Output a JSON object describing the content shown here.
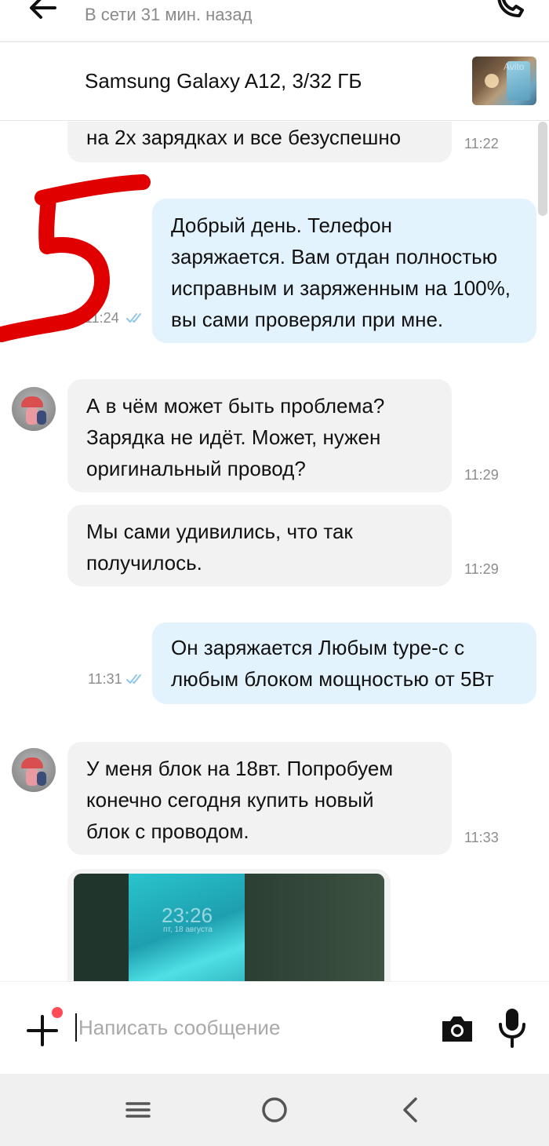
{
  "header": {
    "status": "В сети 31 мин. назад"
  },
  "product": {
    "title": "Samsung Galaxy A12, 3/32 ГБ",
    "thumb_watermark": "Avito"
  },
  "messages": [
    {
      "direction": "in",
      "text": "на 2х зарядках и все безуспешно",
      "time": "11:22"
    },
    {
      "direction": "out",
      "text": "Добрый день. Телефон\nзаряжается. Вам отдан полностью\nисправным и заряженным на 100%,\nвы сами проверяли при мне.",
      "time": "11:24",
      "read": true
    },
    {
      "direction": "in",
      "text": "А в чём может быть проблема?\nЗарядка не идёт. Может, нужен\nоригинальный провод?",
      "time": "11:29"
    },
    {
      "direction": "in",
      "text": "Мы сами удивились, что так\nполучилось.",
      "time": "11:29"
    },
    {
      "direction": "out",
      "text": "Он заряжается Любым type-c с\nлюбым блоком мощностью от 5Вт",
      "time": "11:31",
      "read": true
    },
    {
      "direction": "in",
      "text": "У меня блок на 18вт. Попробуем\nконечно сегодня купить новый\nблок с проводом.",
      "time": "11:33"
    }
  ],
  "photo_message": {
    "clock": "23:26",
    "date": "пт, 18 августа"
  },
  "annotation": {
    "text": "5",
    "color": "#e00000"
  },
  "composer": {
    "placeholder": "Написать сообщение",
    "value": ""
  },
  "colors": {
    "incoming_bubble": "#f2f2f2",
    "outgoing_bubble": "#e3f3fd",
    "read_ticks": "#8ec7e8",
    "attach_badge": "#ff4b55"
  },
  "icons": {
    "back": "arrow-left-icon",
    "call": "phone-icon",
    "attach": "plus-icon",
    "camera": "camera-icon",
    "mic": "microphone-icon",
    "nav_menu": "menu-icon",
    "nav_home": "home-circle-icon",
    "nav_back": "chevron-left-icon"
  }
}
